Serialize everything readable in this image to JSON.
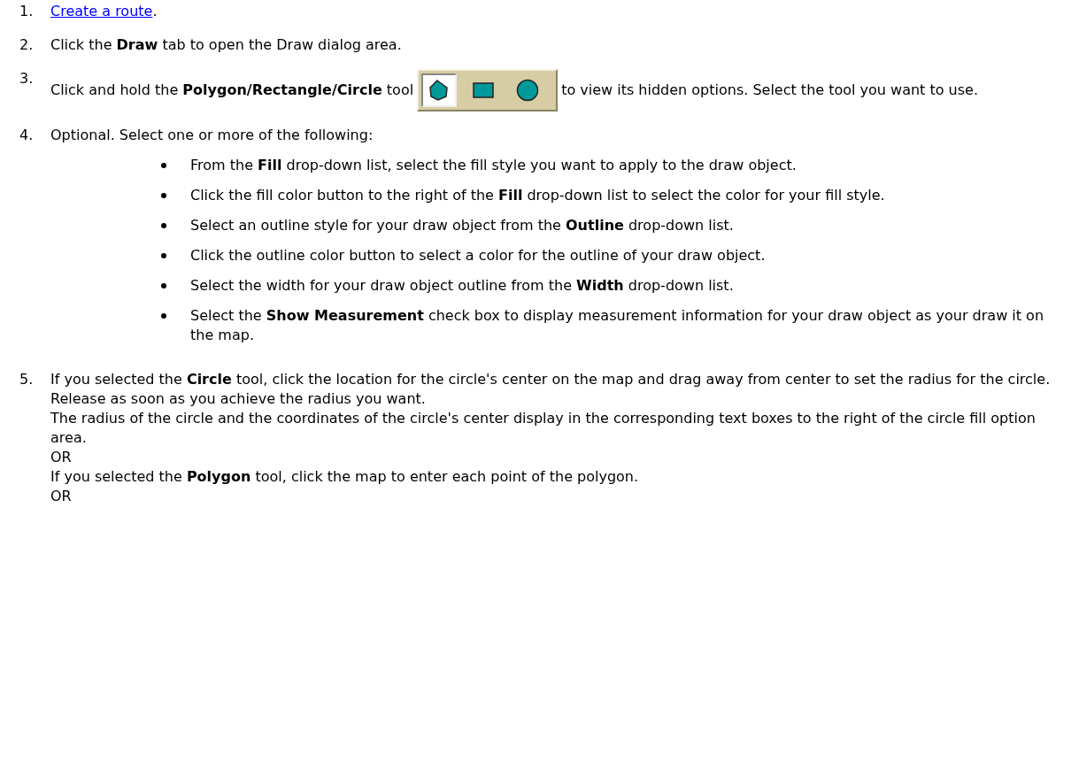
{
  "steps": [
    {
      "number": "1.",
      "kind": "link",
      "link": "Create a route",
      "text": "."
    },
    {
      "number": "2.",
      "kind": "text",
      "text": "Click the **Draw** tab to open the Draw dialog area."
    },
    {
      "number": "3.",
      "kind": "tool",
      "text": "Click and hold the **Polygon/Rectangle/Circle** tool",
      "text_after": "to view its hidden options. Select the tool you want to use.",
      "tools": [
        {
          "kind": "polygon",
          "selected": true
        },
        {
          "kind": "rectangle",
          "selected": false
        },
        {
          "kind": "circle",
          "selected": false
        }
      ]
    },
    {
      "number": "4.",
      "kind": "bullets",
      "text": "Optional. Select one or more of the following:",
      "bullets": [
        "From the **Fill** drop-down list, select the fill style you want to apply to the draw object.",
        "Click the fill color button to the right of the **Fill** drop-down list to select the color for your fill style.",
        "Select an outline style for your draw object from the **Outline** drop-down list.",
        "Click the outline color button to select a color for the outline of your draw object.",
        "Select the width for your draw object outline from the **Width** drop-down list.",
        "Select the **Show Measurement** check box to display measurement information for your draw object as your draw it on the map."
      ]
    },
    {
      "number": "5.",
      "kind": "paragraphs",
      "paragraphs": [
        "If you selected the **Circle** tool, click the location for the circle's center on the map and drag away from center to set the radius for the circle. Release as soon as you achieve the radius you want.",
        "The radius of the circle and the coordinates of the circle's center display in the corresponding text boxes to the right of the circle fill option area.",
        "OR",
        "If you selected the **Polygon** tool, click the map to enter each point of the polygon.",
        "OR"
      ]
    }
  ]
}
